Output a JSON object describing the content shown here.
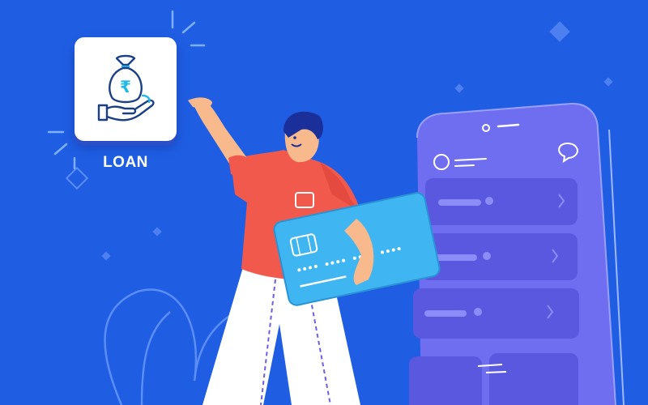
{
  "tile": {
    "label": "LOAN",
    "icon": "money-bag-in-hand-icon",
    "currency_symbol": "₹"
  },
  "colors": {
    "background": "#1f5ee3",
    "tile": "#ffffff",
    "icon_stroke": "#1b3f86",
    "icon_accent": "#1fb8e8",
    "phone_body": "#6f6ef0",
    "phone_card": "#5a58df",
    "shirt": "#f2594d",
    "card": "#3fb6f2",
    "hair": "#1a2f9a"
  }
}
